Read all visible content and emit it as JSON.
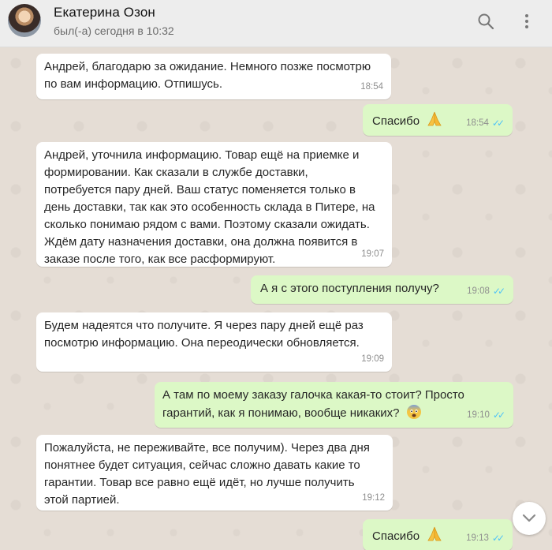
{
  "contact": {
    "name": "Екатерина Озон",
    "status": "был(-а) сегодня в 10:32"
  },
  "header_icons": [
    "search-icon",
    "kebab-menu-icon"
  ],
  "colors": {
    "incoming_bubble": "#ffffff",
    "outgoing_bubble": "#dcf8c6",
    "read_ticks": "#4fc3f7",
    "chat_background": "#e5ddd5"
  },
  "messages": [
    {
      "direction": "in",
      "text": "Андрей, благодарю за ожидание. Немного позже посмотрю\nпо вам информацию. Отпишусь.",
      "time": "18:54"
    },
    {
      "direction": "out",
      "text": "Спасибо",
      "emoji": "folded-hands",
      "time": "18:54",
      "read": true
    },
    {
      "direction": "in",
      "text": "Андрей, уточнила информацию. Товар ещё на приемке и\nформировании. Как сказали в службе доставки,\nпотребуется пару дней. Ваш статус поменяется только в\nдень доставки, так как это особенность склада в Питере, на\nсколько понимаю рядом с вами. Поэтому сказали ожидать.\nЖдём дату назначения доставки, она должна появится в\nзаказе после того, как все расформируют.",
      "time": "19:07"
    },
    {
      "direction": "out",
      "text": "А я с этого поступления получу?",
      "time": "19:08",
      "read": true
    },
    {
      "direction": "in",
      "text": "Будем надеятся что получите. Я через пару дней ещё раз\nпосмотрю информацию. Она переодически обновляется.",
      "time": "19:09"
    },
    {
      "direction": "out",
      "text": "А там по моему заказу галочка какая-то стоит? Просто\nгарантий, как я понимаю, вообще никаких?",
      "emoji": "fearful-face",
      "time": "19:10",
      "read": true
    },
    {
      "direction": "in",
      "text": "Пожалуйста, не переживайте, все получим). Через два дня\nпонятнее будет ситуация, сейчас сложно давать какие то\nгарантии. Товар все равно ещё идёт, но лучше получить\nэтой партией.",
      "time": "19:12"
    },
    {
      "direction": "out",
      "text": "Спасибо",
      "emoji": "folded-hands",
      "time": "19:13",
      "read": true
    }
  ],
  "scroll_button_icon": "chevron-down-icon"
}
